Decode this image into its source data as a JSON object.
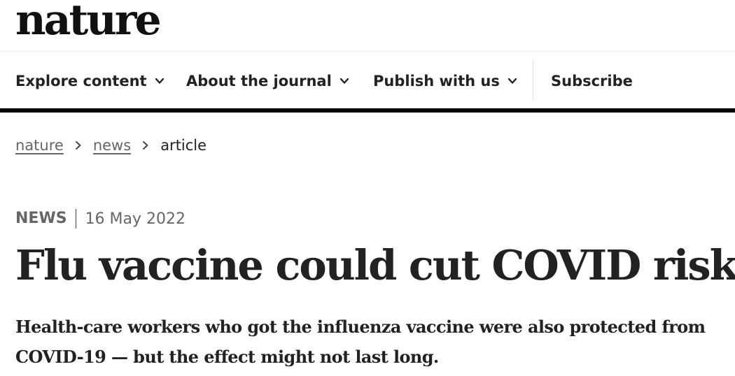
{
  "masthead": {
    "logo_text": "nature"
  },
  "nav": {
    "items": [
      {
        "label": "Explore content",
        "icon": "chevron-down-icon"
      },
      {
        "label": "About the journal",
        "icon": "chevron-down-icon"
      },
      {
        "label": "Publish with us",
        "icon": "chevron-down-icon"
      }
    ],
    "subscribe_label": "Subscribe"
  },
  "breadcrumb": {
    "items": [
      {
        "label": "nature",
        "link": true
      },
      {
        "label": "news",
        "link": true
      },
      {
        "label": "article",
        "link": false
      }
    ],
    "separator_icon": "chevron-right-icon"
  },
  "article": {
    "type": "NEWS",
    "date": "16 May 2022",
    "title": "Flu vaccine could cut COVID risk",
    "standfirst": "Health-care workers who got the influenza vaccine were also protected from COVID-19 — but the effect might not last long."
  },
  "colors": {
    "text": "#222222",
    "muted": "#666666",
    "rule": "#000000"
  }
}
